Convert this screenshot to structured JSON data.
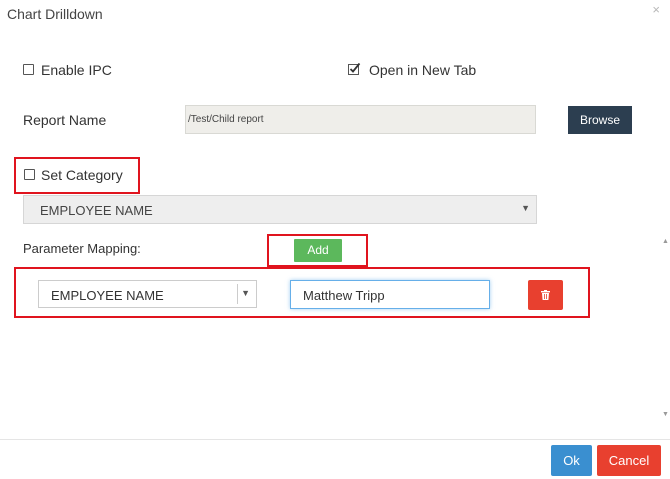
{
  "dialog": {
    "title": "Chart Drilldown",
    "close_glyph": "×"
  },
  "options": {
    "enable_ipc": {
      "label": "Enable IPC",
      "checked": false
    },
    "open_in_new_tab": {
      "label": "Open in New Tab",
      "checked": true
    }
  },
  "report": {
    "label": "Report Name",
    "value": "/Test/Child report",
    "browse_label": "Browse"
  },
  "category": {
    "label": "Set Category",
    "checked": false,
    "selected": "EMPLOYEE NAME"
  },
  "mapping": {
    "label": "Parameter Mapping:",
    "add_label": "Add",
    "rows": [
      {
        "parameter": "EMPLOYEE NAME",
        "value": "Matthew Tripp"
      }
    ]
  },
  "footer": {
    "ok_label": "Ok",
    "cancel_label": "Cancel"
  },
  "colors": {
    "highlight": "#e0141e",
    "browse_bg": "#2c3e50",
    "add_bg": "#5cb85c",
    "delete_bg": "#e8402f",
    "ok_bg": "#3a8fd0",
    "cancel_bg": "#e8402f"
  },
  "icons": {
    "close": "close-icon",
    "checkbox_checked": "checkmark-icon",
    "dropdown": "chevron-down-icon",
    "delete": "trash-icon",
    "scroll_up": "scroll-up-icon",
    "scroll_down": "scroll-down-icon"
  }
}
